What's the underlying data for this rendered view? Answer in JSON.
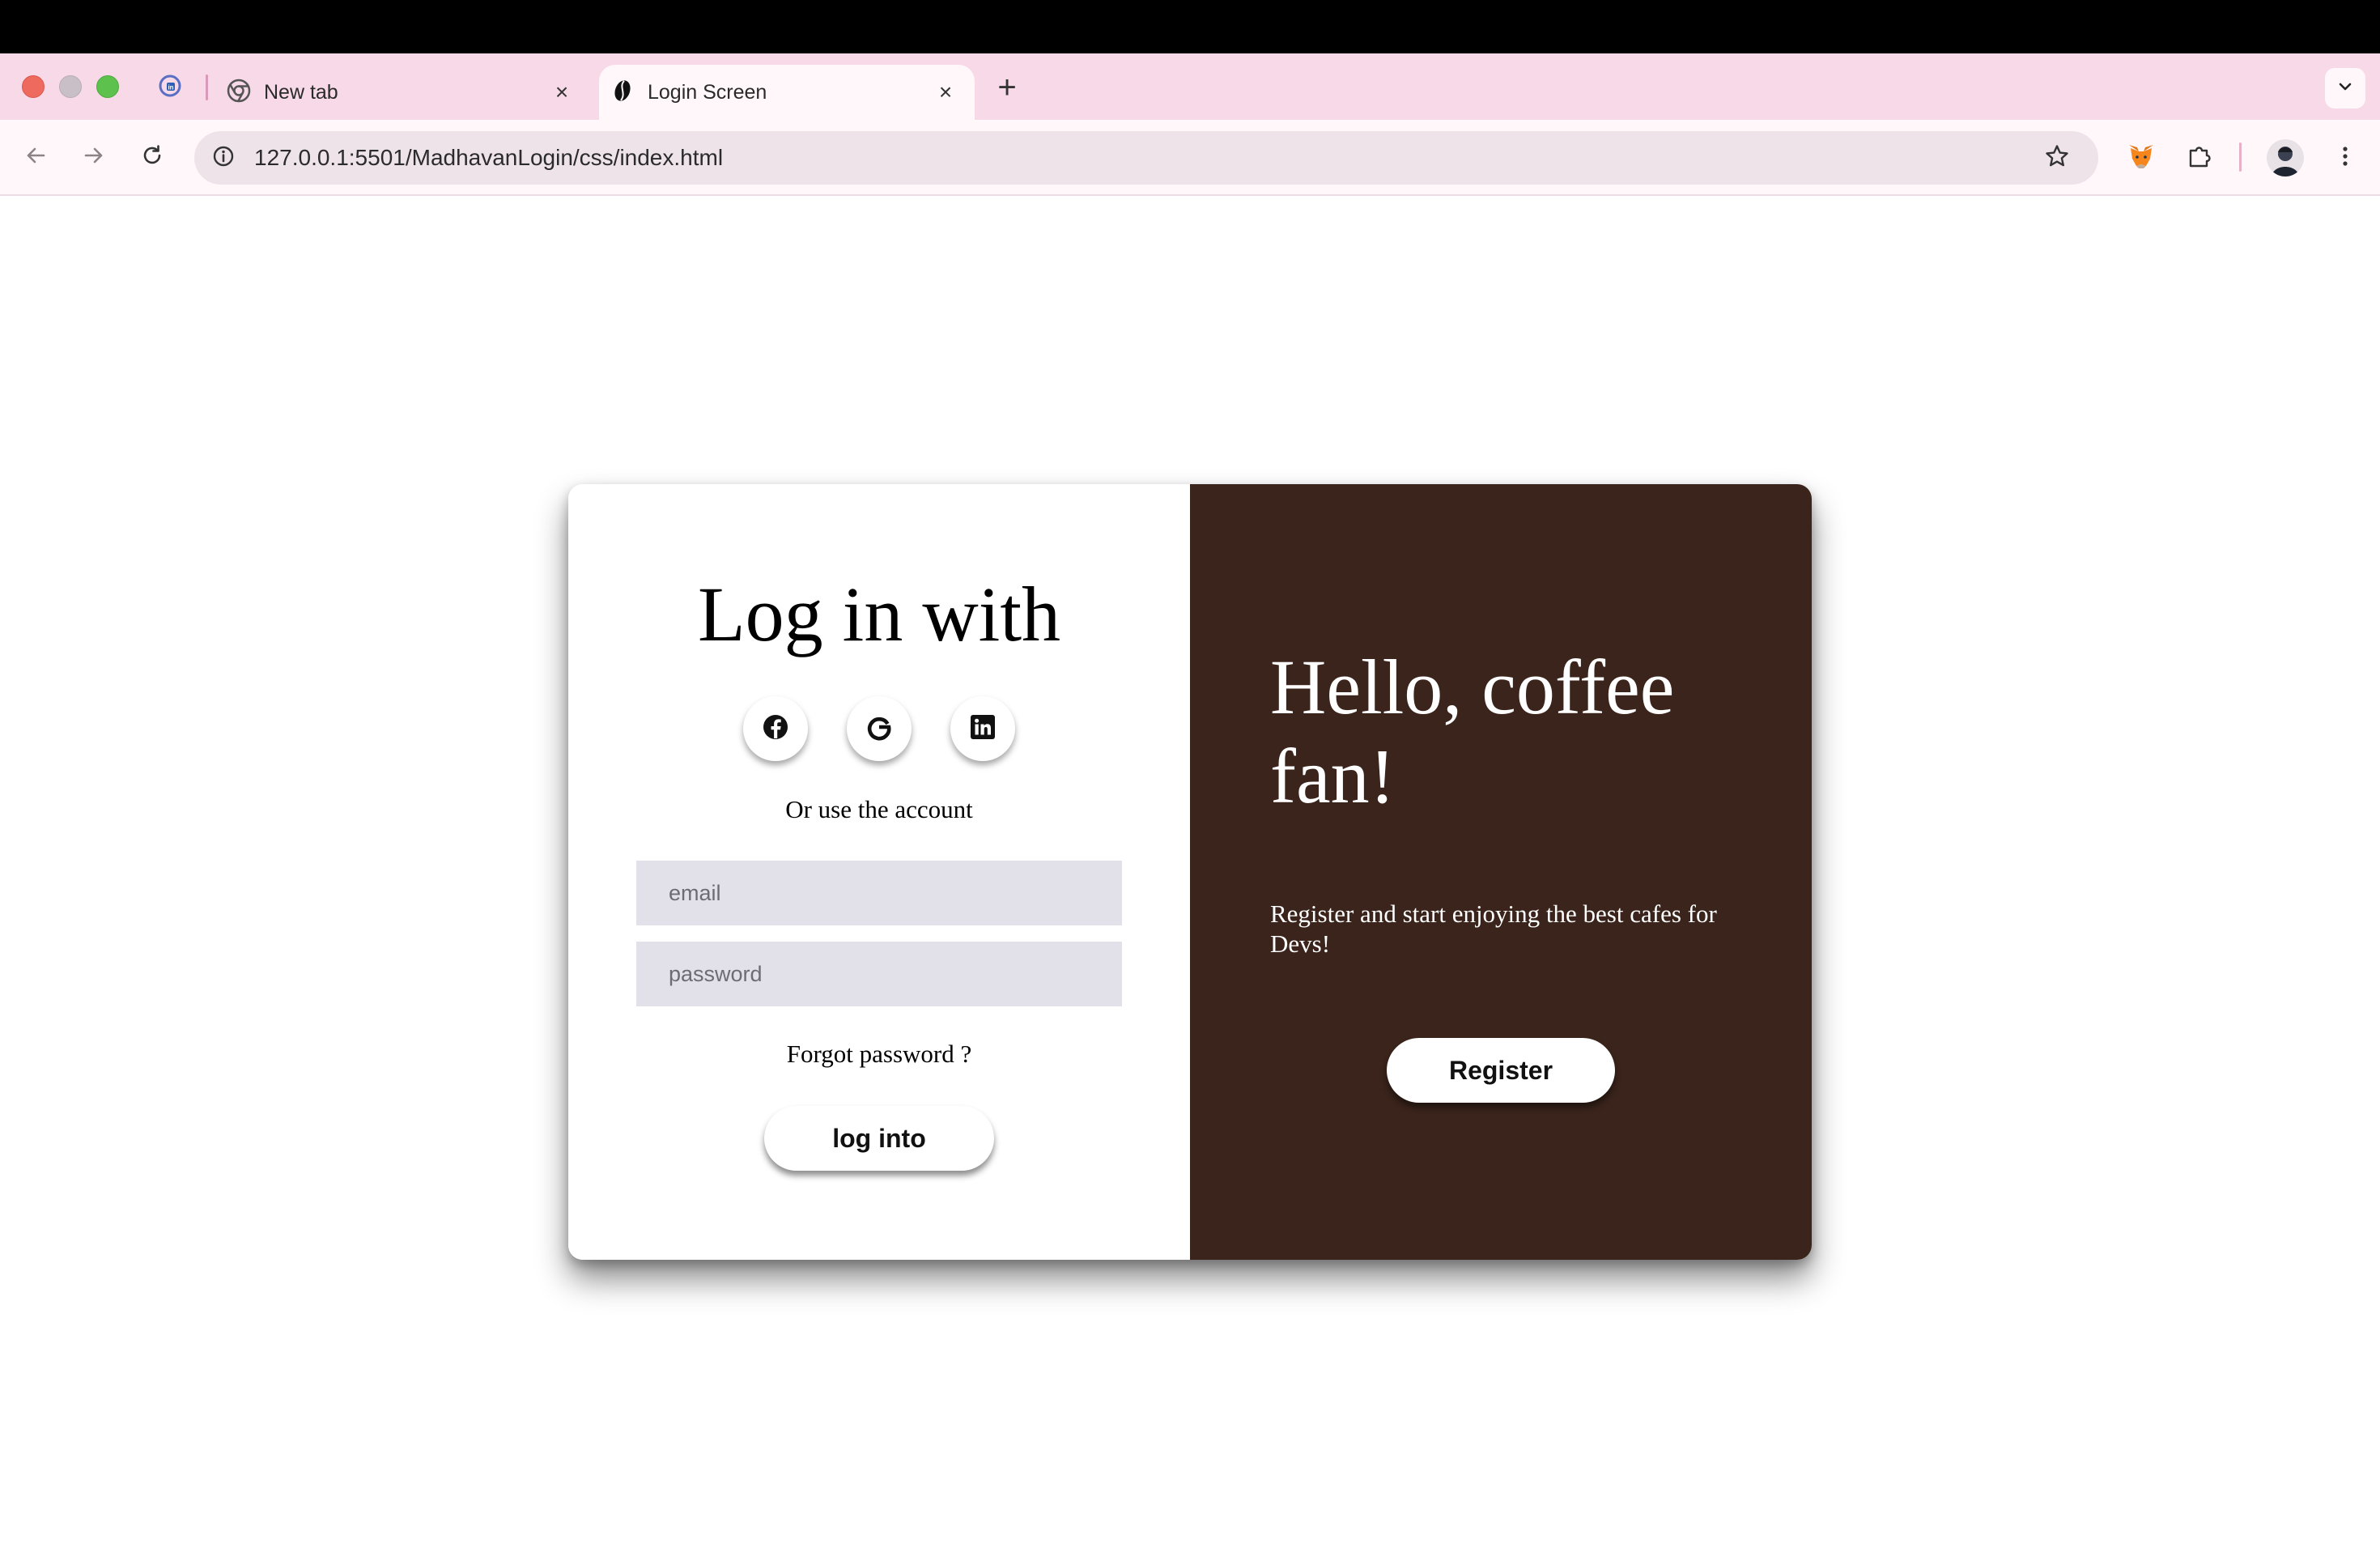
{
  "browser": {
    "tabs": [
      {
        "title": "New tab"
      },
      {
        "title": "Login Screen"
      }
    ],
    "close_glyph": "×",
    "new_tab_glyph": "+",
    "url": "127.0.0.1:5501/MadhavanLogin/css/index.html",
    "icons": {
      "pinned_tab": "linkedin-favicon-icon",
      "newtab_favicon": "chrome-icon",
      "active_favicon": "coffee-bean-icon",
      "back": "arrow-left-icon",
      "forward": "arrow-right-icon",
      "reload": "reload-icon",
      "site_info": "info-icon",
      "bookmark": "star-icon",
      "extension_1": "metamask-fox-icon",
      "extension_2": "puzzle-icon",
      "menu": "kebab-menu-icon"
    }
  },
  "login": {
    "title": "Log in with",
    "social": [
      "facebook-icon",
      "google-icon",
      "linkedin-icon"
    ],
    "alt_text": "Or use the account",
    "email_placeholder": "email",
    "password_placeholder": "password",
    "forgot": "Forgot password ?",
    "submit_label": "log into"
  },
  "welcome": {
    "title": "Hello, coffee fan!",
    "text": "Register and start enjoying the best cafes for Devs!",
    "button_label": "Register"
  },
  "colors": {
    "tabstrip": "#f7d9e7",
    "toolbar": "#fff7f9",
    "omnibox": "#efe3ea",
    "panel_brown": "#3a241b",
    "input_bg": "#e2e0e9"
  }
}
